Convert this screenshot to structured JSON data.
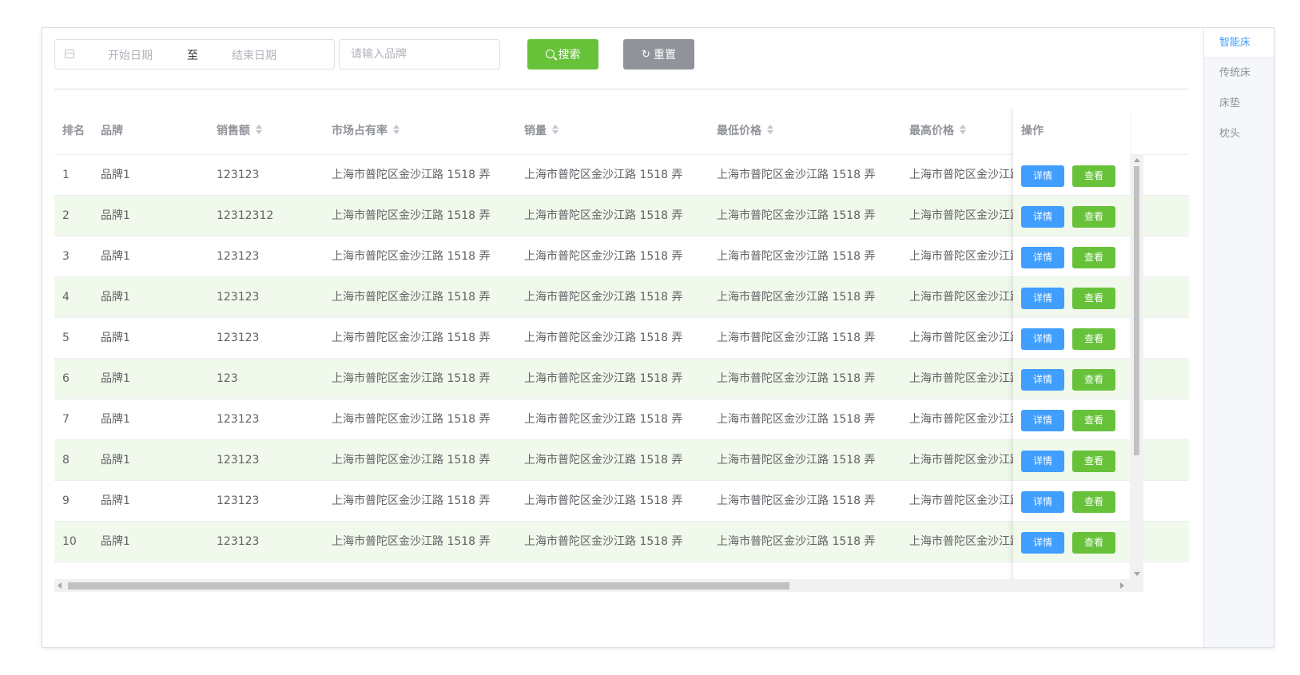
{
  "filters": {
    "start_placeholder": "开始日期",
    "range_separator": "至",
    "end_placeholder": "结束日期",
    "brand_placeholder": "请输入品牌",
    "search_label": "搜索",
    "reset_label": "重置"
  },
  "table": {
    "headers": {
      "rank": "排名",
      "brand": "品牌",
      "sales": "销售额",
      "share": "市场占有率",
      "volume": "销量",
      "min_price": "最低价格",
      "max_price": "最高价格",
      "action": "操作"
    },
    "detail_label": "详情",
    "view_label": "查看",
    "rows": [
      {
        "rank": "1",
        "brand": "品牌1",
        "sales": "123123",
        "share": "上海市普陀区金沙江路 1518 弄",
        "volume": "上海市普陀区金沙江路 1518 弄",
        "min_price": "上海市普陀区金沙江路 1518 弄",
        "max_price": "上海市普陀区金沙江路"
      },
      {
        "rank": "2",
        "brand": "品牌1",
        "sales": "12312312",
        "share": "上海市普陀区金沙江路 1518 弄",
        "volume": "上海市普陀区金沙江路 1518 弄",
        "min_price": "上海市普陀区金沙江路 1518 弄",
        "max_price": "上海市普陀区金沙江路"
      },
      {
        "rank": "3",
        "brand": "品牌1",
        "sales": "123123",
        "share": "上海市普陀区金沙江路 1518 弄",
        "volume": "上海市普陀区金沙江路 1518 弄",
        "min_price": "上海市普陀区金沙江路 1518 弄",
        "max_price": "上海市普陀区金沙江路"
      },
      {
        "rank": "4",
        "brand": "品牌1",
        "sales": "123123",
        "share": "上海市普陀区金沙江路 1518 弄",
        "volume": "上海市普陀区金沙江路 1518 弄",
        "min_price": "上海市普陀区金沙江路 1518 弄",
        "max_price": "上海市普陀区金沙江路"
      },
      {
        "rank": "5",
        "brand": "品牌1",
        "sales": "123123",
        "share": "上海市普陀区金沙江路 1518 弄",
        "volume": "上海市普陀区金沙江路 1518 弄",
        "min_price": "上海市普陀区金沙江路 1518 弄",
        "max_price": "上海市普陀区金沙江路"
      },
      {
        "rank": "6",
        "brand": "品牌1",
        "sales": "123",
        "share": "上海市普陀区金沙江路 1518 弄",
        "volume": "上海市普陀区金沙江路 1518 弄",
        "min_price": "上海市普陀区金沙江路 1518 弄",
        "max_price": "上海市普陀区金沙江路"
      },
      {
        "rank": "7",
        "brand": "品牌1",
        "sales": "123123",
        "share": "上海市普陀区金沙江路 1518 弄",
        "volume": "上海市普陀区金沙江路 1518 弄",
        "min_price": "上海市普陀区金沙江路 1518 弄",
        "max_price": "上海市普陀区金沙江路"
      },
      {
        "rank": "8",
        "brand": "品牌1",
        "sales": "123123",
        "share": "上海市普陀区金沙江路 1518 弄",
        "volume": "上海市普陀区金沙江路 1518 弄",
        "min_price": "上海市普陀区金沙江路 1518 弄",
        "max_price": "上海市普陀区金沙江路"
      },
      {
        "rank": "9",
        "brand": "品牌1",
        "sales": "123123",
        "share": "上海市普陀区金沙江路 1518 弄",
        "volume": "上海市普陀区金沙江路 1518 弄",
        "min_price": "上海市普陀区金沙江路 1518 弄",
        "max_price": "上海市普陀区金沙江路"
      },
      {
        "rank": "10",
        "brand": "品牌1",
        "sales": "123123",
        "share": "上海市普陀区金沙江路 1518 弄",
        "volume": "上海市普陀区金沙江路 1518 弄",
        "min_price": "上海市普陀区金沙江路 1518 弄",
        "max_price": "上海市普陀区金沙江路"
      }
    ]
  },
  "tabs": [
    {
      "label": "智能床",
      "active": true
    },
    {
      "label": "传统床",
      "active": false
    },
    {
      "label": "床垫",
      "active": false
    },
    {
      "label": "枕头",
      "active": false
    }
  ]
}
